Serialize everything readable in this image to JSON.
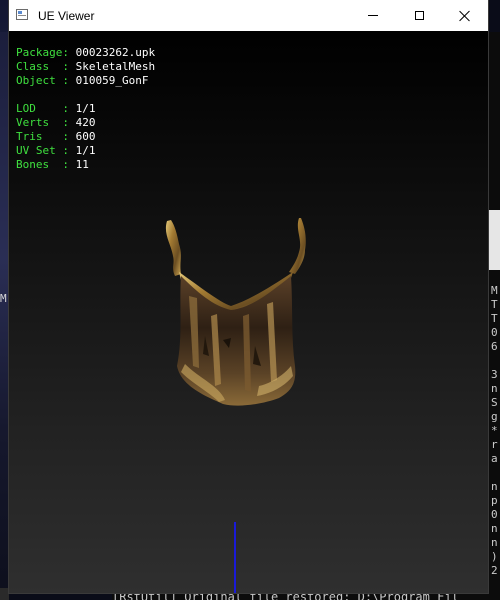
{
  "window": {
    "title": "UE Viewer"
  },
  "info": {
    "package_key": "Package:",
    "package_value": "00023262.upk",
    "class_key": "Class  :",
    "class_value": "SkeletalMesh",
    "object_key": "Object :",
    "object_value": "010059_GonF",
    "lod_key": "LOD    :",
    "lod_value": "1/1",
    "verts_key": "Verts  :",
    "verts_value": "420",
    "tris_key": "Tris   :",
    "tris_value": "600",
    "uvset_key": "UV Set :",
    "uvset_value": "1/1",
    "bones_key": "Bones  :",
    "bones_value": "11"
  },
  "console": {
    "lines": [
      "M",
      "T",
      "T",
      "0",
      "6",
      "",
      "3",
      "n",
      "S",
      "g",
      "*",
      "r",
      "a",
      "",
      "n",
      "p",
      "0",
      "n",
      "n",
      ")",
      "2"
    ],
    "bottom_line": "[RstUtil] Original file restored: D:\\Program Fil"
  },
  "desktop": {
    "left_glyph": "M"
  },
  "colors": {
    "info_key": "#3fe03f",
    "info_value": "#ffffff",
    "axis": "#1a1ad8",
    "mesh_gold": "#b8943a",
    "mesh_dark": "#3a2a18"
  },
  "icons": {
    "app": "app-window-icon",
    "minimize": "minimize-icon",
    "maximize": "maximize-icon",
    "close": "close-icon"
  }
}
